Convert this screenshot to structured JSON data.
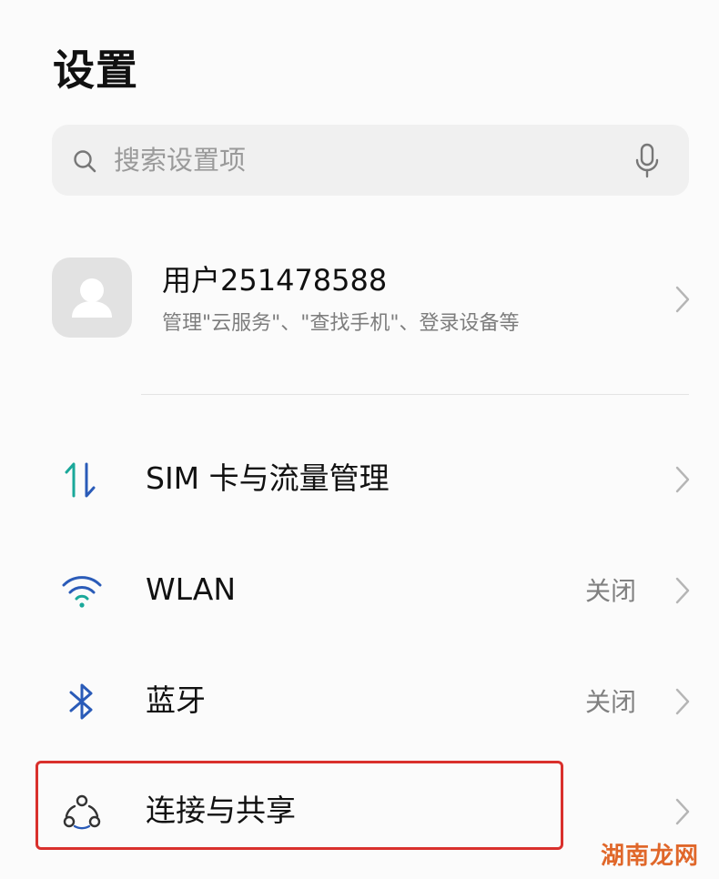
{
  "header": {
    "title": "设置"
  },
  "search": {
    "placeholder": "搜索设置项",
    "search_icon": "search-icon",
    "mic_icon": "microphone-icon"
  },
  "account": {
    "name": "用户251478588",
    "subtitle": "管理\"云服务\"、\"查找手机\"、登录设备等",
    "avatar_icon": "person-placeholder-icon"
  },
  "settings": {
    "items": [
      {
        "label": "SIM 卡与流量管理",
        "value": "",
        "icon": "data-transfer-arrows-icon"
      },
      {
        "label": "WLAN",
        "value": "关闭",
        "icon": "wifi-icon"
      },
      {
        "label": "蓝牙",
        "value": "关闭",
        "icon": "bluetooth-icon"
      },
      {
        "label": "连接与共享",
        "value": "",
        "icon": "connection-share-icon"
      }
    ]
  },
  "annotation": {
    "highlight_color": "#d9302c"
  },
  "watermark": {
    "text": "湖南龙网"
  },
  "colors": {
    "background": "#fbfbfb",
    "search_bg": "#f0f0f0",
    "accent_blue": "#2a5bb8",
    "accent_teal": "#1aa89a",
    "secondary_text": "#808080"
  }
}
